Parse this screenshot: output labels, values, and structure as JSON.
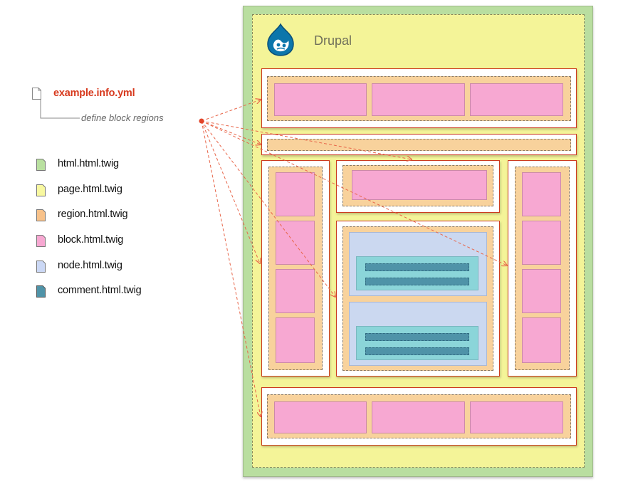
{
  "info_file": {
    "name": "example.info.yml",
    "annotation": "define block regions"
  },
  "legend": [
    {
      "label": "html.html.twig",
      "color": "#b9e0a0"
    },
    {
      "label": "page.html.twig",
      "color": "#f8f8a0"
    },
    {
      "label": "region.html.twig",
      "color": "#f8c28a"
    },
    {
      "label": "block.html.twig",
      "color": "#f7a8d2"
    },
    {
      "label": "node.html.twig",
      "color": "#cbd8f5"
    },
    {
      "label": "comment.html.twig",
      "color": "#4f93a8"
    }
  ],
  "page": {
    "brand": "Drupal",
    "logo_icon": "drupal-drop-icon"
  },
  "colors": {
    "arrow": "#e8664a",
    "region_border": "#cc3b20",
    "info_title": "#d7391d"
  }
}
